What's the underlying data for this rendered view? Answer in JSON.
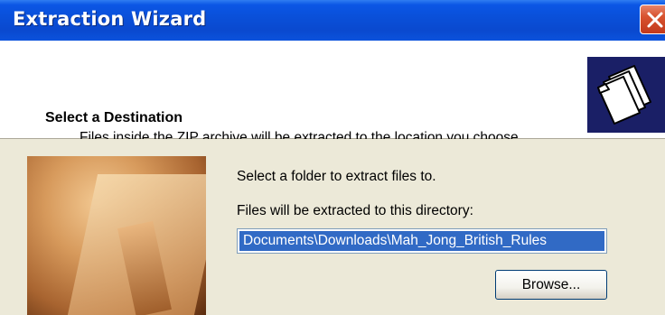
{
  "window": {
    "title": "Extraction Wizard",
    "close_icon": "close-icon",
    "colors": {
      "titlebar": "#0a4fd8",
      "close": "#d8532f",
      "selection": "#316ac5",
      "face": "#ece9d8"
    }
  },
  "header": {
    "heading": "Select a Destination",
    "description": "Files inside the ZIP archive will be extracted to the location you choose.",
    "icon": "folder-stack-icon"
  },
  "body": {
    "side_image": "folder-photo",
    "select_label": "Select a folder to extract files to.",
    "directory_label": "Files will be extracted to this directory:",
    "path_value": "Documents\\Downloads\\Mah_Jong_British_Rules",
    "browse_label": "Browse..."
  }
}
